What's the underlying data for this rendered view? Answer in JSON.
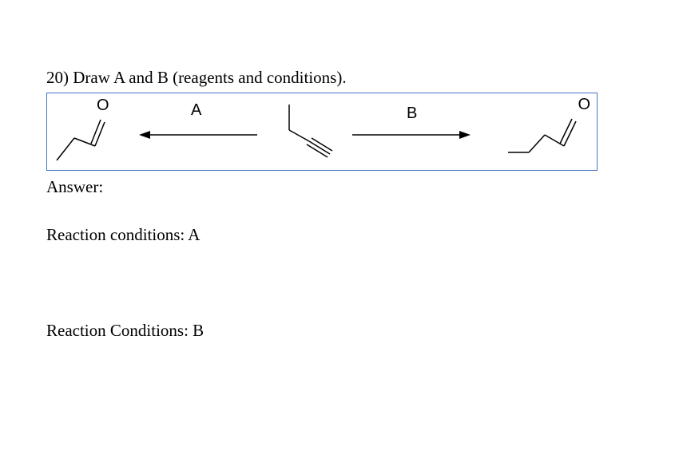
{
  "question": {
    "number": "20)",
    "text": "Draw A and B (reagents and conditions)."
  },
  "diagram": {
    "label_a": "A",
    "label_b": "B",
    "oxygen_left": "O",
    "oxygen_right": "O"
  },
  "answer_label": "Answer:",
  "conditions_a": "Reaction conditions: A",
  "conditions_b": "Reaction Conditions: B"
}
